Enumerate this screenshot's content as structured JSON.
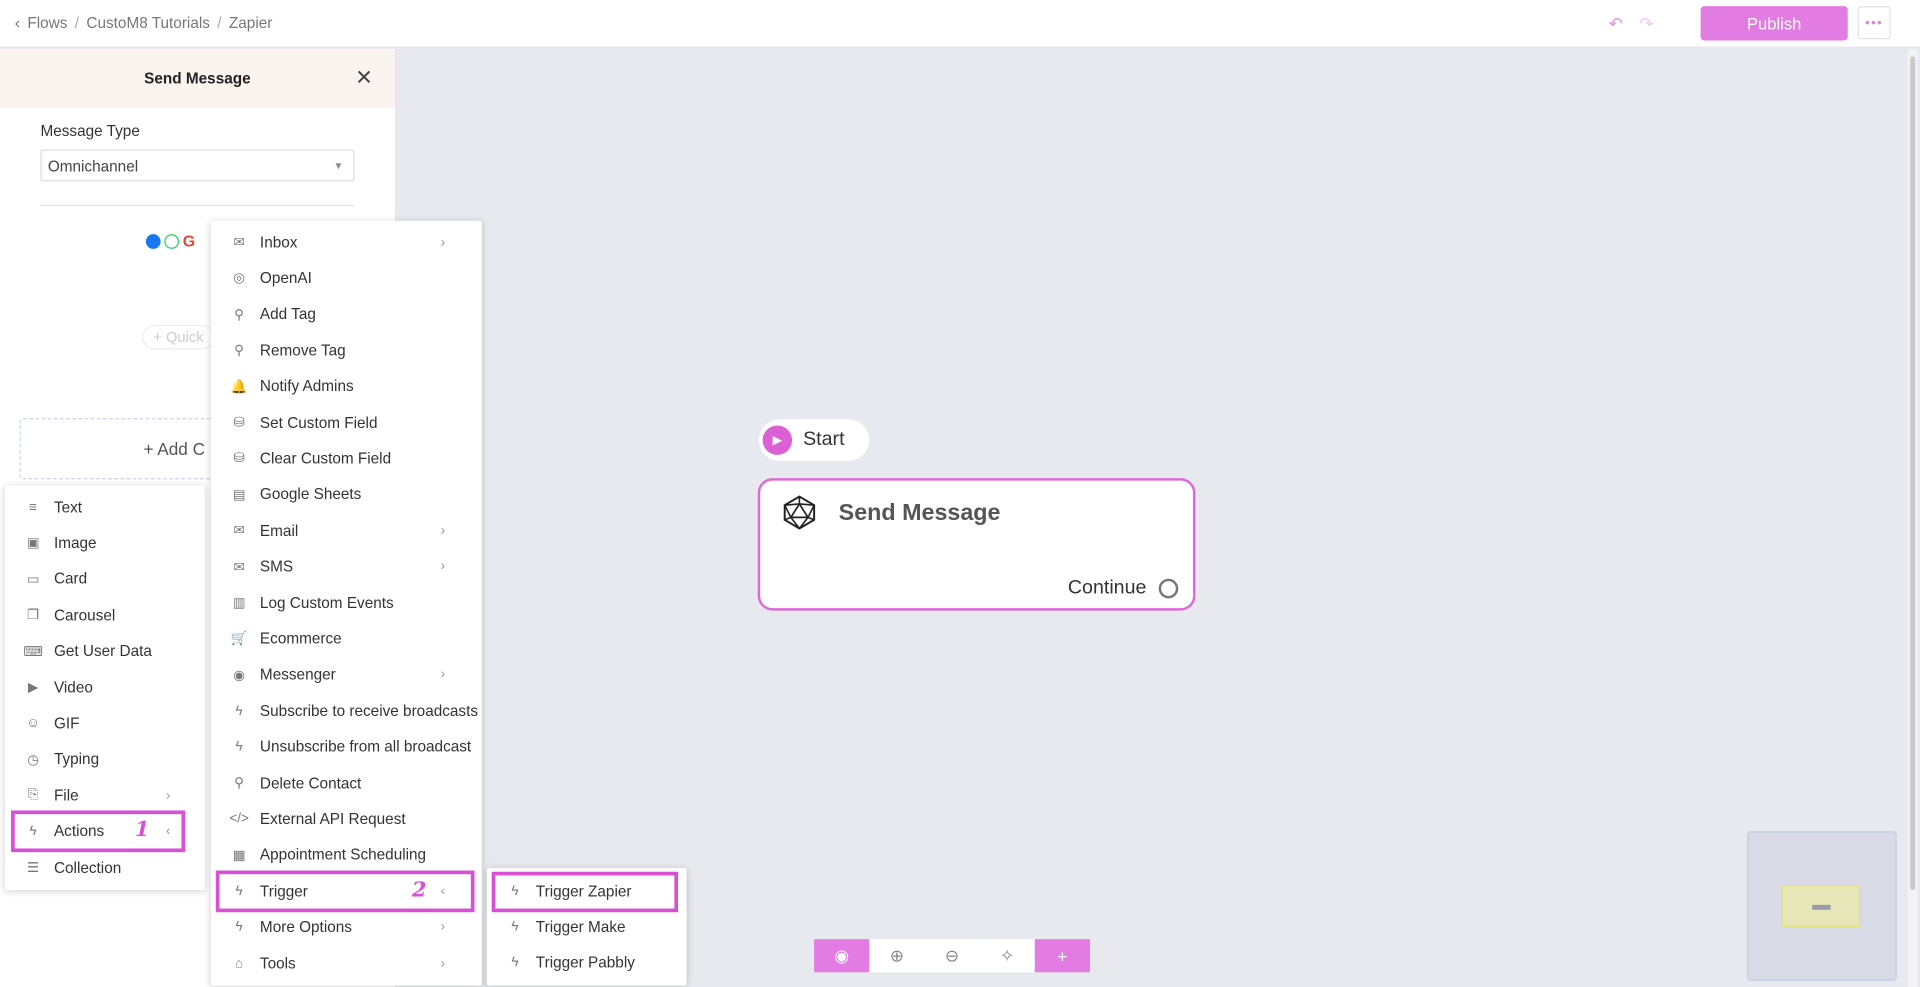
{
  "breadcrumb": {
    "items": [
      "Flows",
      "CustoM8 Tutorials",
      "Zapier"
    ],
    "sep": "/"
  },
  "toolbar": {
    "publish_label": "Publish",
    "more_label": "•••",
    "undo_icon": "↶",
    "redo_icon": "↷"
  },
  "panel": {
    "title": "Send Message",
    "close_icon": "✕",
    "message_type_label": "Message Type",
    "message_type_value": "Omnichannel",
    "quick_reply_label": "+ Quick",
    "add_content_label": "+ Add C"
  },
  "content_menu": {
    "items": [
      {
        "label": "Text",
        "icon": "≡"
      },
      {
        "label": "Image",
        "icon": "▣"
      },
      {
        "label": "Card",
        "icon": "▭"
      },
      {
        "label": "Carousel",
        "icon": "❐"
      },
      {
        "label": "Get User Data",
        "icon": "⌨"
      },
      {
        "label": "Video",
        "icon": "▶"
      },
      {
        "label": "GIF",
        "icon": "☺"
      },
      {
        "label": "Typing",
        "icon": "◷"
      },
      {
        "label": "File",
        "icon": "⎘",
        "chevron": "›"
      },
      {
        "label": "Actions",
        "icon": "ϟ",
        "chevron": "‹"
      },
      {
        "label": "Collection",
        "icon": "☰"
      }
    ]
  },
  "actions_menu": {
    "items": [
      {
        "label": "Inbox",
        "icon": "✉",
        "chevron": "›"
      },
      {
        "label": "OpenAI",
        "icon": "◎"
      },
      {
        "label": "Add Tag",
        "icon": "⚲"
      },
      {
        "label": "Remove Tag",
        "icon": "⚲"
      },
      {
        "label": "Notify Admins",
        "icon": "🔔"
      },
      {
        "label": "Set Custom Field",
        "icon": "⛁"
      },
      {
        "label": "Clear Custom Field",
        "icon": "⛁"
      },
      {
        "label": "Google Sheets",
        "icon": "▤"
      },
      {
        "label": "Email",
        "icon": "✉",
        "chevron": "›"
      },
      {
        "label": "SMS",
        "icon": "✉",
        "chevron": "›"
      },
      {
        "label": "Log Custom Events",
        "icon": "▥"
      },
      {
        "label": "Ecommerce",
        "icon": "🛒"
      },
      {
        "label": "Messenger",
        "icon": "◉",
        "chevron": "›"
      },
      {
        "label": "Subscribe to receive broadcasts",
        "icon": "ϟ"
      },
      {
        "label": "Unsubscribe from all broadcast",
        "icon": "ϟ"
      },
      {
        "label": "Delete Contact",
        "icon": "⚲"
      },
      {
        "label": "External API Request",
        "icon": "</>"
      },
      {
        "label": "Appointment Scheduling",
        "icon": "▦"
      },
      {
        "label": "Trigger",
        "icon": "ϟ",
        "chevron": "‹"
      },
      {
        "label": "More Options",
        "icon": "ϟ",
        "chevron": "›"
      },
      {
        "label": "Tools",
        "icon": "⌂",
        "chevron": "›"
      }
    ]
  },
  "trigger_menu": {
    "items": [
      {
        "label": "Trigger Zapier",
        "icon": "ϟ"
      },
      {
        "label": "Trigger Make",
        "icon": "ϟ"
      },
      {
        "label": "Trigger Pabbly",
        "icon": "ϟ"
      }
    ]
  },
  "annotations": {
    "step1": "1",
    "step2": "2"
  },
  "canvas": {
    "start_label": "Start",
    "node_title": "Send Message",
    "node_continue": "Continue"
  },
  "zoom_controls": {
    "preview_icon": "◉",
    "zoom_in_icon": "⊕",
    "zoom_out_icon": "⊖",
    "auto_arrange_icon": "✧",
    "add_icon": "+"
  },
  "colors": {
    "accent": "#e27ce3",
    "highlight": "#d94fd6",
    "canvas_bg": "#e8e9ee"
  }
}
